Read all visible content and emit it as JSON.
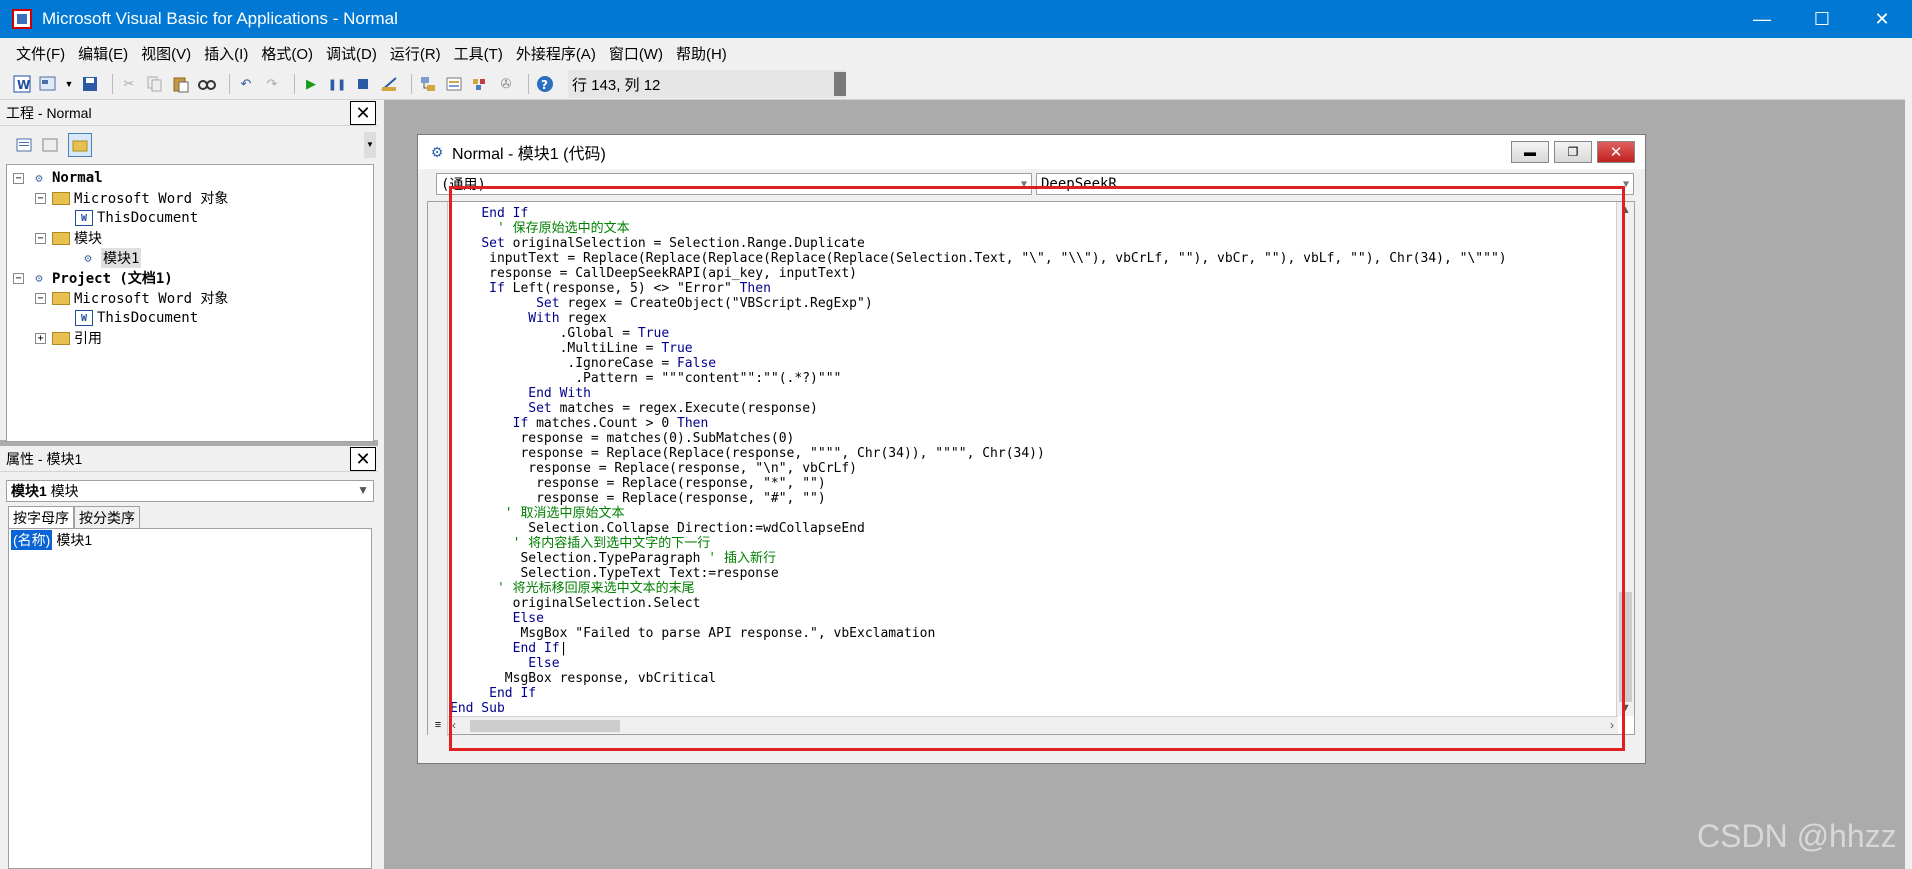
{
  "window": {
    "title": "Microsoft Visual Basic for Applications - Normal",
    "min_glyph": "—",
    "max_glyph": "☐",
    "close_glyph": "✕"
  },
  "menu": [
    "文件(F)",
    "编辑(E)",
    "视图(V)",
    "插入(I)",
    "格式(O)",
    "调试(D)",
    "运行(R)",
    "工具(T)",
    "外接程序(A)",
    "窗口(W)",
    "帮助(H)"
  ],
  "toolbar": {
    "cursor_position": "行 143, 列 12",
    "icons": [
      "word-icon",
      "insert-userform-icon",
      "save-icon",
      "cut-icon",
      "copy-icon",
      "paste-icon",
      "find-icon",
      "undo-icon",
      "redo-icon",
      "run-icon",
      "break-icon",
      "reset-icon",
      "design-mode-icon",
      "project-explorer-icon",
      "properties-icon",
      "object-browser-icon",
      "toolbox-icon",
      "help-icon"
    ]
  },
  "project_panel": {
    "title": "工程 - Normal",
    "tree": [
      {
        "label": "Normal",
        "level": 0,
        "toggle": "−",
        "icon": "vba-project-icon"
      },
      {
        "label": "Microsoft Word 对象",
        "level": 1,
        "toggle": "−",
        "icon": "folder-icon"
      },
      {
        "label": "ThisDocument",
        "level": 2,
        "toggle": "",
        "icon": "word-document-icon"
      },
      {
        "label": "模块",
        "level": 1,
        "toggle": "−",
        "icon": "folder-icon"
      },
      {
        "label": "模块1",
        "level": 2,
        "toggle": "",
        "icon": "module-icon"
      },
      {
        "label": "Project (文档1)",
        "level": 0,
        "toggle": "−",
        "icon": "vba-project-icon"
      },
      {
        "label": "Microsoft Word 对象",
        "level": 1,
        "toggle": "−",
        "icon": "folder-icon"
      },
      {
        "label": "ThisDocument",
        "level": 2,
        "toggle": "",
        "icon": "word-document-icon"
      },
      {
        "label": "引用",
        "level": 1,
        "toggle": "+",
        "icon": "folder-icon"
      }
    ]
  },
  "properties_panel": {
    "title": "属性 - 模块1",
    "object_name": "模块1",
    "object_type": "模块",
    "tabs": [
      "按字母序",
      "按分类序"
    ],
    "property_key": "(名称)",
    "property_value": "模块1"
  },
  "code_window": {
    "title": "Normal - 模块1 (代码)",
    "object_combo": "(通用)",
    "proc_combo": "DeepSeekR",
    "lines": [
      {
        "indent": "    ",
        "tokens": [
          {
            "t": "End If",
            "c": "kw"
          }
        ]
      },
      {
        "indent": "      ",
        "tokens": [
          {
            "t": "' 保存原始选中的文本",
            "c": "cm"
          }
        ]
      },
      {
        "indent": "    ",
        "tokens": [
          {
            "t": "Set",
            "c": "kw"
          },
          {
            "t": " originalSelection = Selection.Range.Duplicate",
            "c": ""
          }
        ]
      },
      {
        "indent": "     ",
        "tokens": [
          {
            "t": "inputText = Replace(Replace(Replace(Replace(Replace(Selection.Text, \"\\\", \"\\\\\"), vbCrLf, \"\"), vbCr, \"\"), vbLf, \"\"), Chr(34), \"\\\"\"\")",
            "c": ""
          }
        ]
      },
      {
        "indent": "     ",
        "tokens": [
          {
            "t": "response = CallDeepSeekRAPI(api_key, inputText)",
            "c": ""
          }
        ]
      },
      {
        "indent": "     ",
        "tokens": [
          {
            "t": "If",
            "c": "kw"
          },
          {
            "t": " Left(response, 5) <> \"Error\" ",
            "c": ""
          },
          {
            "t": "Then",
            "c": "kw"
          }
        ]
      },
      {
        "indent": "           ",
        "tokens": [
          {
            "t": "Set",
            "c": "kw"
          },
          {
            "t": " regex = CreateObject(\"VBScript.RegExp\")",
            "c": ""
          }
        ]
      },
      {
        "indent": "          ",
        "tokens": [
          {
            "t": "With",
            "c": "kw"
          },
          {
            "t": " regex",
            "c": ""
          }
        ]
      },
      {
        "indent": "              ",
        "tokens": [
          {
            "t": ".Global = ",
            "c": ""
          },
          {
            "t": "True",
            "c": "kw"
          }
        ]
      },
      {
        "indent": "              ",
        "tokens": [
          {
            "t": ".MultiLine = ",
            "c": ""
          },
          {
            "t": "True",
            "c": "kw"
          }
        ]
      },
      {
        "indent": "               ",
        "tokens": [
          {
            "t": ".IgnoreCase = ",
            "c": ""
          },
          {
            "t": "False",
            "c": "kw"
          }
        ]
      },
      {
        "indent": "                ",
        "tokens": [
          {
            "t": ".Pattern = \"\"\"content\"\":\"\"(.*?)\"\"\"",
            "c": ""
          }
        ]
      },
      {
        "indent": "          ",
        "tokens": [
          {
            "t": "End With",
            "c": "kw"
          }
        ]
      },
      {
        "indent": "          ",
        "tokens": [
          {
            "t": "Set",
            "c": "kw"
          },
          {
            "t": " matches = regex.Execute(response)",
            "c": ""
          }
        ]
      },
      {
        "indent": "        ",
        "tokens": [
          {
            "t": "If",
            "c": "kw"
          },
          {
            "t": " matches.Count > 0 ",
            "c": ""
          },
          {
            "t": "Then",
            "c": "kw"
          }
        ]
      },
      {
        "indent": "         ",
        "tokens": [
          {
            "t": "response = matches(0).SubMatches(0)",
            "c": ""
          }
        ]
      },
      {
        "indent": "         ",
        "tokens": [
          {
            "t": "response = Replace(Replace(response, \"\"\"\", Chr(34)), \"\"\"\", Chr(34))",
            "c": ""
          }
        ]
      },
      {
        "indent": "          ",
        "tokens": [
          {
            "t": "response = Replace(response, \"\\n\", vbCrLf)",
            "c": ""
          }
        ]
      },
      {
        "indent": "           ",
        "tokens": [
          {
            "t": "response = Replace(response, \"*\", \"\")",
            "c": ""
          }
        ]
      },
      {
        "indent": "           ",
        "tokens": [
          {
            "t": "response = Replace(response, \"#\", \"\")",
            "c": ""
          }
        ]
      },
      {
        "indent": "       ",
        "tokens": [
          {
            "t": "' 取消选中原始文本",
            "c": "cm"
          }
        ]
      },
      {
        "indent": "          ",
        "tokens": [
          {
            "t": "Selection.Collapse Direction:=wdCollapseEnd",
            "c": ""
          }
        ]
      },
      {
        "indent": "        ",
        "tokens": [
          {
            "t": "' 将内容插入到选中文字的下一行",
            "c": "cm"
          }
        ]
      },
      {
        "indent": "         ",
        "tokens": [
          {
            "t": "Selection.TypeParagraph ",
            "c": ""
          },
          {
            "t": "' 插入新行",
            "c": "cm"
          }
        ]
      },
      {
        "indent": "         ",
        "tokens": [
          {
            "t": "Selection.TypeText Text:=response",
            "c": ""
          }
        ]
      },
      {
        "indent": "      ",
        "tokens": [
          {
            "t": "' 将光标移回原来选中文本的末尾",
            "c": "cm"
          }
        ]
      },
      {
        "indent": "        ",
        "tokens": [
          {
            "t": "originalSelection.Select",
            "c": ""
          }
        ]
      },
      {
        "indent": "        ",
        "tokens": [
          {
            "t": "Else",
            "c": "kw"
          }
        ]
      },
      {
        "indent": "         ",
        "tokens": [
          {
            "t": "MsgBox \"Failed to parse API response.\", vbExclamation",
            "c": ""
          }
        ]
      },
      {
        "indent": "        ",
        "tokens": [
          {
            "t": "End If",
            "c": "kw"
          },
          {
            "t": "|",
            "c": ""
          }
        ]
      },
      {
        "indent": "          ",
        "tokens": [
          {
            "t": "Else",
            "c": "kw"
          }
        ]
      },
      {
        "indent": "       ",
        "tokens": [
          {
            "t": "MsgBox response, vbCritical",
            "c": ""
          }
        ]
      },
      {
        "indent": "     ",
        "tokens": [
          {
            "t": "End If",
            "c": "kw"
          }
        ]
      },
      {
        "indent": "",
        "tokens": [
          {
            "t": "End Sub",
            "c": "kw"
          }
        ]
      }
    ]
  },
  "watermark": "CSDN @hhzz",
  "colors": {
    "titlebar": "#0078d4",
    "keyword": "#00008b",
    "comment": "#008000",
    "highlight_box": "#e02020"
  }
}
